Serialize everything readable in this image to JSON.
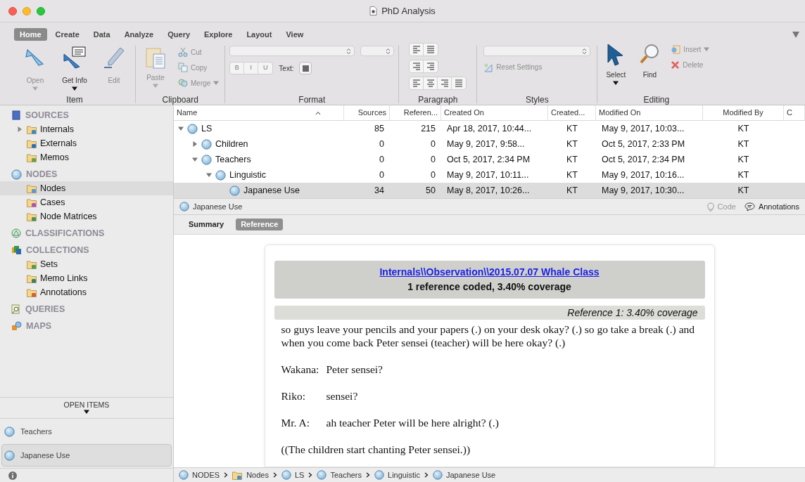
{
  "window": {
    "title": "PhD Analysis"
  },
  "ribbon": {
    "tabs": [
      {
        "label": "Home",
        "selected": true
      },
      {
        "label": "Create",
        "selected": false
      },
      {
        "label": "Data",
        "selected": false
      },
      {
        "label": "Analyze",
        "selected": false
      },
      {
        "label": "Query",
        "selected": false
      },
      {
        "label": "Explore",
        "selected": false
      },
      {
        "label": "Layout",
        "selected": false
      },
      {
        "label": "View",
        "selected": false
      }
    ],
    "item_group": {
      "label": "Item",
      "buttons": [
        {
          "label": "Open",
          "disabled": true,
          "dropdown": true
        },
        {
          "label": "Get Info",
          "disabled": false,
          "dropdown": true
        },
        {
          "label": "Edit",
          "disabled": true,
          "dropdown": false
        }
      ]
    },
    "clipboard_group": {
      "label": "Clipboard",
      "paste": {
        "label": "Paste",
        "disabled": true,
        "dropdown": true
      },
      "actions": [
        {
          "label": "Cut",
          "disabled": true,
          "dropdown": false
        },
        {
          "label": "Copy",
          "disabled": true,
          "dropdown": false
        },
        {
          "label": "Merge",
          "disabled": true,
          "dropdown": true
        }
      ]
    },
    "format_group": {
      "label": "Format",
      "style_buttons": [
        "B",
        "I",
        "U"
      ],
      "text_color_label": "Text:"
    },
    "paragraph_group": {
      "label": "Paragraph"
    },
    "styles_group": {
      "label": "Styles",
      "reset": {
        "label": "Reset Settings",
        "disabled": true
      }
    },
    "editing_group": {
      "label": "Editing",
      "tools": [
        {
          "label": "Select",
          "dropdown": true
        },
        {
          "label": "Find",
          "dropdown": false
        }
      ],
      "actions": [
        {
          "label": "Insert",
          "disabled": true,
          "dropdown": true
        },
        {
          "label": "Delete",
          "disabled": true,
          "dropdown": false
        }
      ]
    }
  },
  "sidebar": {
    "sections": [
      {
        "title": "SOURCES",
        "kind": "sources",
        "items": [
          {
            "label": "Internals",
            "collapsed": true,
            "selected": false
          },
          {
            "label": "Externals",
            "collapsed": false,
            "selected": false
          },
          {
            "label": "Memos",
            "collapsed": false,
            "selected": false
          }
        ]
      },
      {
        "title": "NODES",
        "kind": "nodes",
        "items": [
          {
            "label": "Nodes",
            "collapsed": false,
            "selected": true
          },
          {
            "label": "Cases",
            "collapsed": false,
            "selected": false
          },
          {
            "label": "Node Matrices",
            "collapsed": false,
            "selected": false
          }
        ]
      },
      {
        "title": "CLASSIFICATIONS",
        "kind": "classifications"
      },
      {
        "title": "COLLECTIONS",
        "kind": "collections",
        "items": [
          {
            "label": "Sets",
            "collapsed": false,
            "selected": false
          },
          {
            "label": "Memo Links",
            "collapsed": false,
            "selected": false
          },
          {
            "label": "Annotations",
            "collapsed": false,
            "selected": false
          }
        ]
      },
      {
        "title": "QUERIES",
        "kind": "queries"
      },
      {
        "title": "MAPS",
        "kind": "maps"
      }
    ],
    "open_items": {
      "title": "OPEN ITEMS",
      "items": [
        {
          "label": "Teachers",
          "selected": false
        },
        {
          "label": "Japanese Use",
          "selected": true
        }
      ]
    }
  },
  "table": {
    "columns": [
      "Name",
      "Sources",
      "Referen...",
      "Created On",
      "Created...",
      "Modified On",
      "Modified By",
      "C"
    ],
    "rows": [
      {
        "name": "LS",
        "kind": "parent",
        "expanded": true,
        "selected": false,
        "sources": "85",
        "references": "215",
        "created_on": "Apr 18, 2017, 10:44...",
        "created_by": "KT",
        "modified_on": "May 9, 2017, 10:03...",
        "modified_by": "KT",
        "children": [
          {
            "name": "Children",
            "kind": "parent",
            "expanded": false,
            "selected": false,
            "sources": "0",
            "references": "0",
            "created_on": "May 9, 2017, 9:58...",
            "created_by": "KT",
            "modified_on": "Oct 5, 2017, 2:33 PM",
            "modified_by": "KT"
          },
          {
            "name": "Teachers",
            "kind": "parent",
            "expanded": true,
            "selected": false,
            "sources": "0",
            "references": "0",
            "created_on": "Oct 5, 2017, 2:34 PM",
            "created_by": "KT",
            "modified_on": "Oct 5, 2017, 2:34 PM",
            "modified_by": "KT",
            "children": [
              {
                "name": "Linguistic",
                "kind": "parent",
                "expanded": true,
                "selected": false,
                "sources": "0",
                "references": "0",
                "created_on": "May 9, 2017, 10:11...",
                "created_by": "KT",
                "modified_on": "May 9, 2017, 10:16...",
                "modified_by": "KT",
                "children": [
                  {
                    "name": "Japanese Use",
                    "kind": "leaf",
                    "selected": true,
                    "sources": "34",
                    "references": "50",
                    "created_on": "May 8, 2017, 10:26...",
                    "created_by": "KT",
                    "modified_on": "May 9, 2017, 10:30...",
                    "modified_by": "KT"
                  }
                ]
              }
            ]
          }
        ]
      }
    ]
  },
  "detail": {
    "title": "Japanese Use",
    "code": {
      "label": "Code",
      "disabled": true
    },
    "annotations": "Annotations",
    "tabs": [
      {
        "label": "Summary",
        "selected": false
      },
      {
        "label": "Reference",
        "selected": true
      }
    ],
    "source_link": "Internals\\\\Observation\\\\2015.07.07 Whale Class",
    "summary": "1 reference coded, 3.40% coverage",
    "reference": "Reference 1: 3.40% coverage",
    "lines": [
      {
        "kind": "narration",
        "text": "so guys leave your pencils and your papers (.) on your desk okay? (.) so go take a break (.) and when you come back Peter sensei (teacher) will be here okay? (.)"
      },
      {
        "kind": "turn",
        "speaker": "Wakana:",
        "text": "Peter sensei?"
      },
      {
        "kind": "turn",
        "speaker": "Riko:",
        "text": "sensei?"
      },
      {
        "kind": "turn",
        "speaker": "Mr. A:",
        "text": "ah teacher Peter will be here alright? (.)"
      },
      {
        "kind": "narration",
        "text": "((The children start chanting Peter sensei.))"
      }
    ]
  },
  "breadcrumb": [
    {
      "label": "NODES",
      "kind": "node"
    },
    {
      "label": "Nodes",
      "kind": "folder"
    },
    {
      "label": "LS",
      "kind": "node"
    },
    {
      "label": "Teachers",
      "kind": "node"
    },
    {
      "label": "Linguistic",
      "kind": "node"
    },
    {
      "label": "Japanese Use",
      "kind": "node"
    }
  ]
}
